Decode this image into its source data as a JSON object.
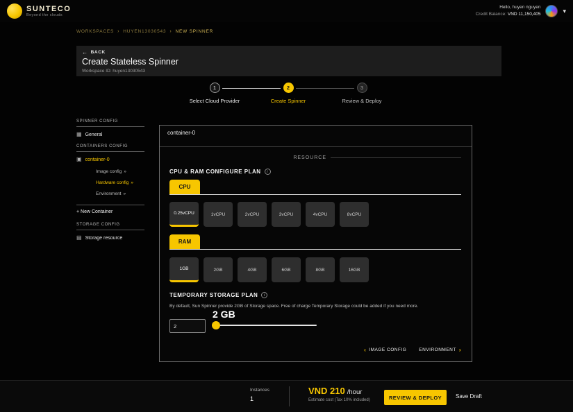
{
  "colors": {
    "accent": "#f7c600"
  },
  "icons": {
    "back_arrow": "←",
    "breadcrumb_sep": "›",
    "caret_down": "▾",
    "info": "i",
    "double_arrow": "»",
    "prev_arrow": "‹",
    "next_arrow": "›",
    "general": "▦",
    "container": "▣",
    "storage": "▤"
  },
  "header": {
    "brand_name": "SUNTECO",
    "brand_tagline": "Beyond the clouds",
    "greeting": "Hello, huyen nguyen",
    "credit_label": "Credit Balance:",
    "credit_value": "VND 11,150,405"
  },
  "breadcrumb": {
    "items": [
      "WORKSPACES",
      "HUYEN13030543",
      "NEW SPINNER"
    ]
  },
  "page": {
    "back_label": "BACK",
    "title": "Create Stateless Spinner",
    "workspace_id": "Workspace ID: huyen13030543"
  },
  "stepper": {
    "steps": [
      {
        "num": "1",
        "label": "Select Cloud Provider",
        "state": "done"
      },
      {
        "num": "2",
        "label": "Create Spinner",
        "state": "active"
      },
      {
        "num": "3",
        "label": "Review & Deploy",
        "state": "pending"
      }
    ]
  },
  "sidebar": {
    "spinner_config_title": "SPINNER CONFIG",
    "general": "General",
    "containers_config_title": "CONTAINERS CONFIG",
    "container_name": "container-0",
    "image_config": "Image config",
    "hardware_config": "Hardware config",
    "environment": "Environment",
    "new_container": "+ New Container",
    "storage_config_title": "STORAGE CONFIG",
    "storage_resource": "Storage resource"
  },
  "panel": {
    "container_title": "container-0",
    "resource_label": "RESOURCE",
    "cpu_ram_title": "CPU & RAM CONFIGURE PLAN",
    "cpu_tab": "CPU",
    "cpu_options": [
      "0.25vCPU",
      "1vCPU",
      "2vCPU",
      "3vCPU",
      "4vCPU",
      "8vCPU"
    ],
    "cpu_selected": "0.25vCPU",
    "ram_tab": "RAM",
    "ram_options": [
      "1GB",
      "2GB",
      "4GB",
      "6GB",
      "8GB",
      "16GB"
    ],
    "ram_selected": "1GB",
    "temp_storage_title": "TEMPORARY STORAGE PLAN",
    "temp_storage_desc": "By default, Sun Spinner provide 2GB of Storage space. Free of charge Temporary Storage could be added if you need more.",
    "storage_display": "2 GB",
    "storage_input_value": "2",
    "nav_prev": "IMAGE CONFIG",
    "nav_next": "ENVIRONMENT"
  },
  "footer": {
    "instances_label": "Instances",
    "instances_value": "1",
    "price": "VND 210",
    "price_unit": "/hour",
    "estimate_note": "Estimate cost (Tax 10% included)",
    "review_deploy": "REVIEW & DEPLOY",
    "save_draft": "Save Draft"
  }
}
